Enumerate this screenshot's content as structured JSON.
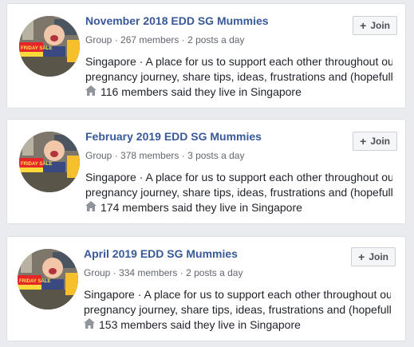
{
  "groups": [
    {
      "name": "November 2018 EDD SG Mummies",
      "type": "Group",
      "members": "267 members",
      "activity": "2 posts a day",
      "desc_line1": "Singapore · A place for us to support each other throughout our",
      "desc_line2": "pregnancy journey, share tips, ideas, frustrations and (hopefully)...",
      "location_note": "116 members said they live in Singapore",
      "join_label": "Join",
      "avatar_banner": "FRIDAY SALE"
    },
    {
      "name": "February 2019 EDD SG Mummies",
      "type": "Group",
      "members": "378 members",
      "activity": "3 posts a day",
      "desc_line1": "Singapore · A place for us to support each other throughout our",
      "desc_line2": "pregnancy journey, share tips, ideas, frustrations and (hopefully)...",
      "location_note": "174 members said they live in Singapore",
      "join_label": "Join",
      "avatar_banner": "FRIDAY SALE"
    },
    {
      "name": "April 2019 EDD SG Mummies",
      "type": "Group",
      "members": "334 members",
      "activity": "2 posts a day",
      "desc_line1": "Singapore · A place for us to support each other throughout our",
      "desc_line2": "pregnancy journey, share tips, ideas, frustrations and (hopefully)...",
      "location_note": "153 members said they live in Singapore",
      "join_label": "Join",
      "avatar_banner": "FRIDAY SALE"
    }
  ],
  "separator": " · ",
  "icons": {
    "join": "plus-icon",
    "location": "house-icon"
  },
  "colors": {
    "title": "#385898",
    "background": "#e9ebee",
    "banner": "#e5252a"
  }
}
